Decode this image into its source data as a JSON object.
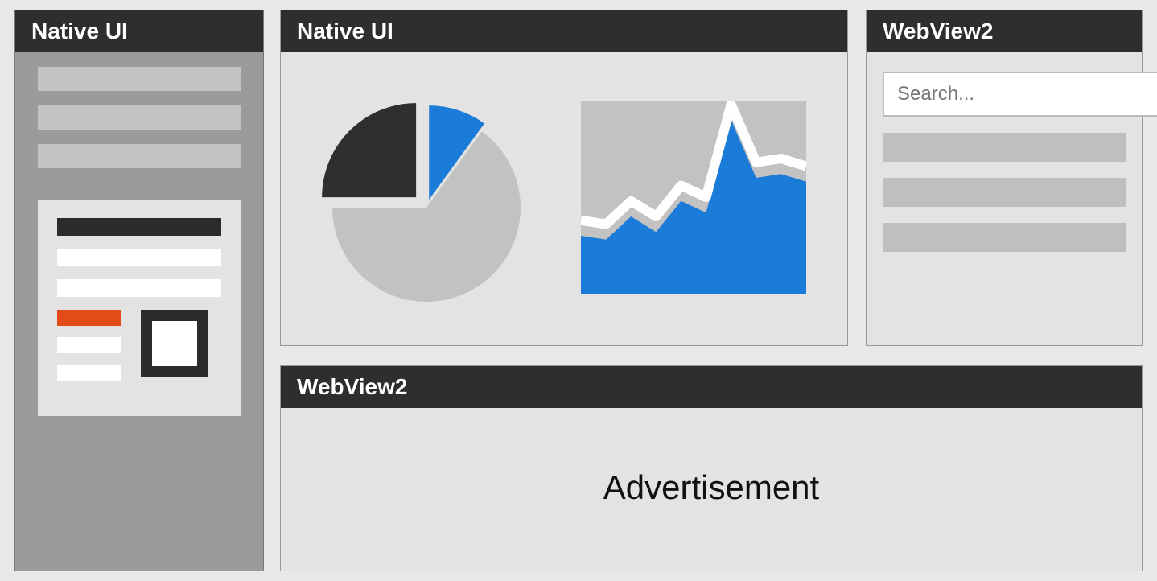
{
  "panels": {
    "left": {
      "title": "Native UI"
    },
    "centerTop": {
      "title": "Native UI"
    },
    "rightTop": {
      "title": "WebView2"
    },
    "bottom": {
      "title": "WebView2",
      "content": "Advertisement"
    }
  },
  "search": {
    "placeholder": "Search...",
    "icon": "search-icon"
  },
  "colors": {
    "accentBlue": "#1b7bd8",
    "darkSlice": "#2f2f2f",
    "lightSlice": "#c2c2c2",
    "orange": "#e34b17"
  },
  "chart_data": [
    {
      "type": "pie",
      "title": "",
      "series": [
        {
          "name": "dark",
          "value": 25
        },
        {
          "name": "blue",
          "value": 10
        },
        {
          "name": "light",
          "value": 65
        }
      ]
    },
    {
      "type": "area",
      "title": "",
      "xlabel": "",
      "ylabel": "",
      "x": [
        0,
        1,
        2,
        3,
        4,
        5,
        6,
        7,
        8,
        9
      ],
      "values": [
        30,
        28,
        40,
        32,
        48,
        42,
        90,
        60,
        62,
        58
      ],
      "ylim": [
        0,
        100
      ]
    }
  ]
}
